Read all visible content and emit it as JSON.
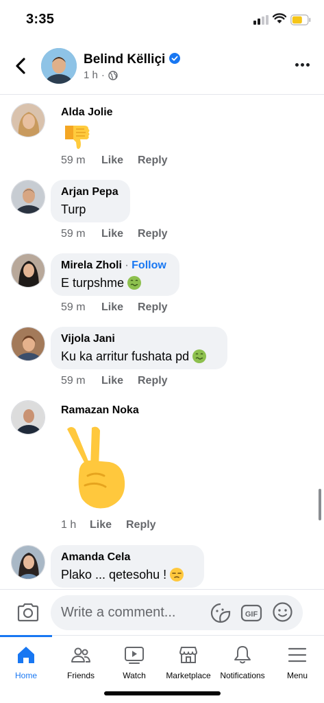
{
  "status_bar": {
    "time": "3:35"
  },
  "post_header": {
    "author": "Belind Këlliçi",
    "time": "1 h",
    "verified": true,
    "audience_icon": "globe-icon"
  },
  "comments": [
    {
      "author": "Alda Jolie",
      "text": "",
      "media": "thumbs-down-emoji",
      "time": "59 m",
      "like": "Like",
      "reply": "Reply"
    },
    {
      "author": "Arjan Pepa",
      "text": "Turp",
      "time": "59 m",
      "like": "Like",
      "reply": "Reply"
    },
    {
      "author": "Mirela Zholi",
      "follow": "Follow",
      "separator": "·",
      "text": "E turpshme",
      "emoji": "nauseated-face-emoji",
      "time": "59 m",
      "like": "Like",
      "reply": "Reply"
    },
    {
      "author": "Vijola Jani",
      "text": "Ku ka arritur fushata pd",
      "emoji": "nauseated-face-emoji",
      "time": "59 m",
      "like": "Like",
      "reply": "Reply"
    },
    {
      "author": "Ramazan Noka",
      "text": "",
      "media": "victory-hand-emoji",
      "time": "1 h",
      "like": "Like",
      "reply": "Reply"
    },
    {
      "author": "Amanda Cela",
      "text": "Plako ... qetesohu !",
      "emoji": "unamused-face-emoji"
    }
  ],
  "composer": {
    "placeholder": "Write a comment..."
  },
  "tabs": [
    {
      "label": "Home",
      "icon": "home-icon",
      "active": true
    },
    {
      "label": "Friends",
      "icon": "friends-icon",
      "active": false
    },
    {
      "label": "Watch",
      "icon": "watch-icon",
      "active": false
    },
    {
      "label": "Marketplace",
      "icon": "marketplace-icon",
      "active": false
    },
    {
      "label": "Notifications",
      "icon": "bell-icon",
      "active": false
    },
    {
      "label": "Menu",
      "icon": "menu-icon",
      "active": false
    }
  ],
  "colors": {
    "brand_blue": "#1877f2",
    "bubble_bg": "#f0f2f5",
    "meta_gray": "#65676b"
  }
}
